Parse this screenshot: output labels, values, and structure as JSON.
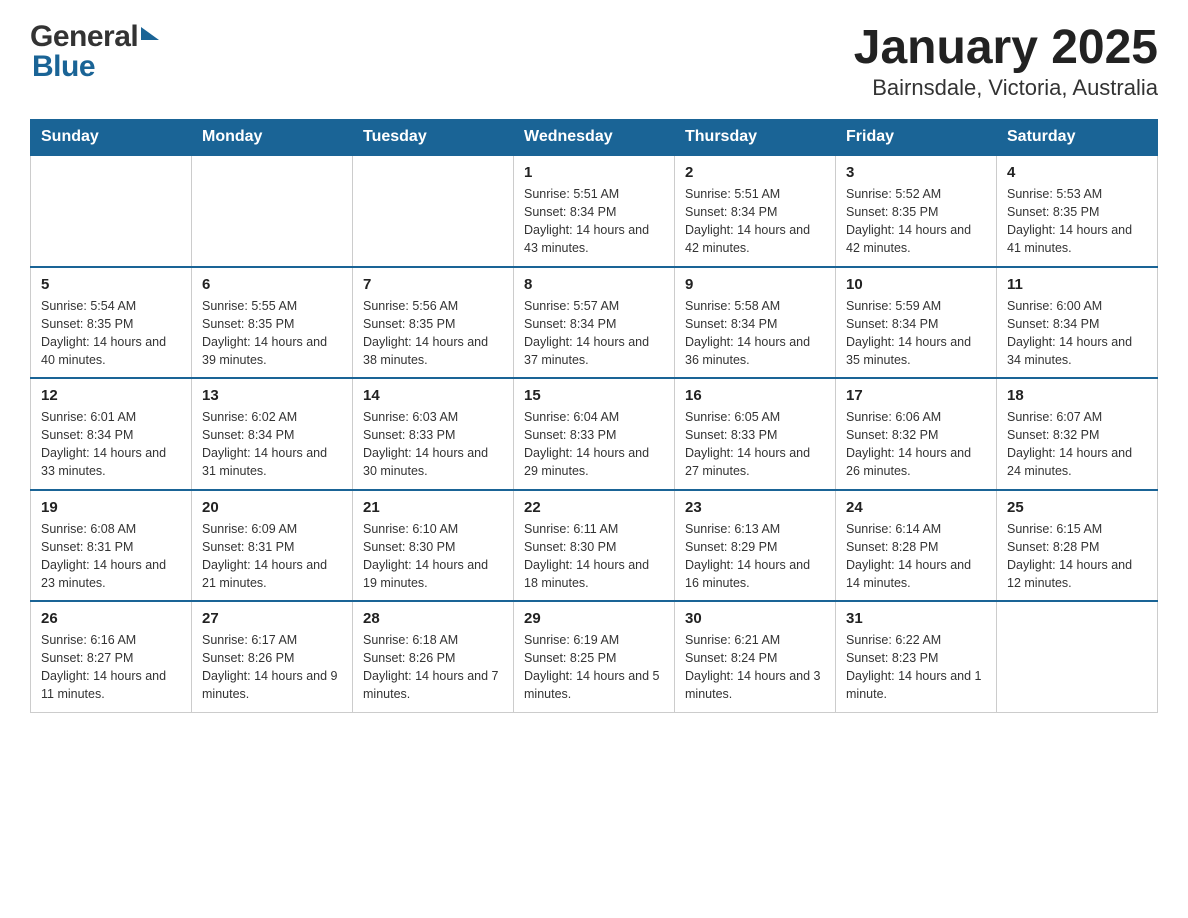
{
  "header": {
    "logo_general": "General",
    "logo_blue": "Blue",
    "title": "January 2025",
    "subtitle": "Bairnsdale, Victoria, Australia"
  },
  "days_of_week": [
    "Sunday",
    "Monday",
    "Tuesday",
    "Wednesday",
    "Thursday",
    "Friday",
    "Saturday"
  ],
  "weeks": [
    [
      {
        "day": "",
        "info": ""
      },
      {
        "day": "",
        "info": ""
      },
      {
        "day": "",
        "info": ""
      },
      {
        "day": "1",
        "info": "Sunrise: 5:51 AM\nSunset: 8:34 PM\nDaylight: 14 hours and 43 minutes."
      },
      {
        "day": "2",
        "info": "Sunrise: 5:51 AM\nSunset: 8:34 PM\nDaylight: 14 hours and 42 minutes."
      },
      {
        "day": "3",
        "info": "Sunrise: 5:52 AM\nSunset: 8:35 PM\nDaylight: 14 hours and 42 minutes."
      },
      {
        "day": "4",
        "info": "Sunrise: 5:53 AM\nSunset: 8:35 PM\nDaylight: 14 hours and 41 minutes."
      }
    ],
    [
      {
        "day": "5",
        "info": "Sunrise: 5:54 AM\nSunset: 8:35 PM\nDaylight: 14 hours and 40 minutes."
      },
      {
        "day": "6",
        "info": "Sunrise: 5:55 AM\nSunset: 8:35 PM\nDaylight: 14 hours and 39 minutes."
      },
      {
        "day": "7",
        "info": "Sunrise: 5:56 AM\nSunset: 8:35 PM\nDaylight: 14 hours and 38 minutes."
      },
      {
        "day": "8",
        "info": "Sunrise: 5:57 AM\nSunset: 8:34 PM\nDaylight: 14 hours and 37 minutes."
      },
      {
        "day": "9",
        "info": "Sunrise: 5:58 AM\nSunset: 8:34 PM\nDaylight: 14 hours and 36 minutes."
      },
      {
        "day": "10",
        "info": "Sunrise: 5:59 AM\nSunset: 8:34 PM\nDaylight: 14 hours and 35 minutes."
      },
      {
        "day": "11",
        "info": "Sunrise: 6:00 AM\nSunset: 8:34 PM\nDaylight: 14 hours and 34 minutes."
      }
    ],
    [
      {
        "day": "12",
        "info": "Sunrise: 6:01 AM\nSunset: 8:34 PM\nDaylight: 14 hours and 33 minutes."
      },
      {
        "day": "13",
        "info": "Sunrise: 6:02 AM\nSunset: 8:34 PM\nDaylight: 14 hours and 31 minutes."
      },
      {
        "day": "14",
        "info": "Sunrise: 6:03 AM\nSunset: 8:33 PM\nDaylight: 14 hours and 30 minutes."
      },
      {
        "day": "15",
        "info": "Sunrise: 6:04 AM\nSunset: 8:33 PM\nDaylight: 14 hours and 29 minutes."
      },
      {
        "day": "16",
        "info": "Sunrise: 6:05 AM\nSunset: 8:33 PM\nDaylight: 14 hours and 27 minutes."
      },
      {
        "day": "17",
        "info": "Sunrise: 6:06 AM\nSunset: 8:32 PM\nDaylight: 14 hours and 26 minutes."
      },
      {
        "day": "18",
        "info": "Sunrise: 6:07 AM\nSunset: 8:32 PM\nDaylight: 14 hours and 24 minutes."
      }
    ],
    [
      {
        "day": "19",
        "info": "Sunrise: 6:08 AM\nSunset: 8:31 PM\nDaylight: 14 hours and 23 minutes."
      },
      {
        "day": "20",
        "info": "Sunrise: 6:09 AM\nSunset: 8:31 PM\nDaylight: 14 hours and 21 minutes."
      },
      {
        "day": "21",
        "info": "Sunrise: 6:10 AM\nSunset: 8:30 PM\nDaylight: 14 hours and 19 minutes."
      },
      {
        "day": "22",
        "info": "Sunrise: 6:11 AM\nSunset: 8:30 PM\nDaylight: 14 hours and 18 minutes."
      },
      {
        "day": "23",
        "info": "Sunrise: 6:13 AM\nSunset: 8:29 PM\nDaylight: 14 hours and 16 minutes."
      },
      {
        "day": "24",
        "info": "Sunrise: 6:14 AM\nSunset: 8:28 PM\nDaylight: 14 hours and 14 minutes."
      },
      {
        "day": "25",
        "info": "Sunrise: 6:15 AM\nSunset: 8:28 PM\nDaylight: 14 hours and 12 minutes."
      }
    ],
    [
      {
        "day": "26",
        "info": "Sunrise: 6:16 AM\nSunset: 8:27 PM\nDaylight: 14 hours and 11 minutes."
      },
      {
        "day": "27",
        "info": "Sunrise: 6:17 AM\nSunset: 8:26 PM\nDaylight: 14 hours and 9 minutes."
      },
      {
        "day": "28",
        "info": "Sunrise: 6:18 AM\nSunset: 8:26 PM\nDaylight: 14 hours and 7 minutes."
      },
      {
        "day": "29",
        "info": "Sunrise: 6:19 AM\nSunset: 8:25 PM\nDaylight: 14 hours and 5 minutes."
      },
      {
        "day": "30",
        "info": "Sunrise: 6:21 AM\nSunset: 8:24 PM\nDaylight: 14 hours and 3 minutes."
      },
      {
        "day": "31",
        "info": "Sunrise: 6:22 AM\nSunset: 8:23 PM\nDaylight: 14 hours and 1 minute."
      },
      {
        "day": "",
        "info": ""
      }
    ]
  ]
}
